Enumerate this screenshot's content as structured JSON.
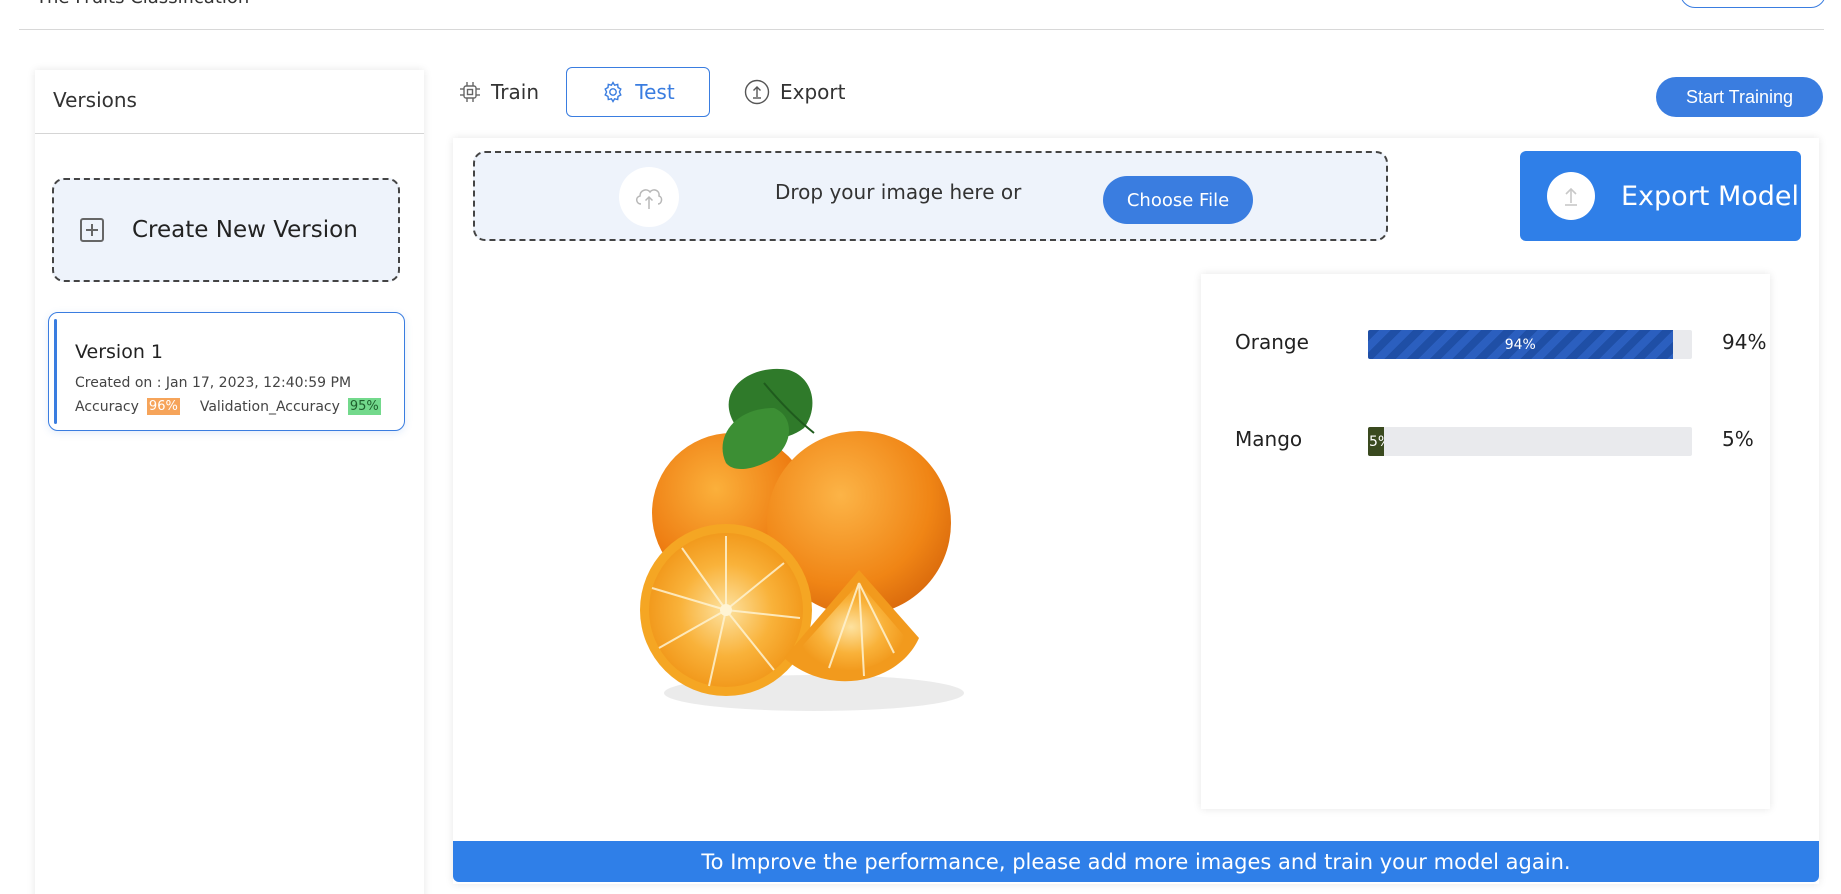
{
  "header": {
    "project_title": "The Fruits Classification"
  },
  "sidebar": {
    "title": "Versions",
    "create_label": "Create New Version",
    "versions": [
      {
        "name": "Version 1",
        "created": "Created on : Jan 17, 2023, 12:40:59 PM",
        "accuracy_label": "Accuracy",
        "accuracy_value": "96%",
        "val_label": "Validation_Accuracy",
        "val_value": "95%"
      }
    ]
  },
  "tabs": [
    {
      "label": "Train",
      "icon": "chip-icon"
    },
    {
      "label": "Test",
      "icon": "gear-icon",
      "active": true
    },
    {
      "label": "Export",
      "icon": "upload-circle-icon"
    }
  ],
  "toolbar": {
    "start_training_label": "Start Training"
  },
  "upload": {
    "drop_text": "Drop your image here or",
    "choose_label": "Choose File"
  },
  "export": {
    "label": "Export Model"
  },
  "results": [
    {
      "label": "Orange",
      "percent": 94,
      "bar_text": "94%",
      "pct_text": "94%"
    },
    {
      "label": "Mango",
      "percent": 5,
      "bar_text": "5%",
      "pct_text": "5%"
    }
  ],
  "footer": {
    "message": "To Improve the performance, please add more images and train your model again."
  },
  "colors": {
    "accent": "#3a7de0",
    "accent_dark": "#2f7fe8",
    "orange_bar": "#1f4fa6",
    "mango_bar": "#3a4a1f",
    "badge_orange": "#f6a45a",
    "badge_green": "#73d98c"
  }
}
